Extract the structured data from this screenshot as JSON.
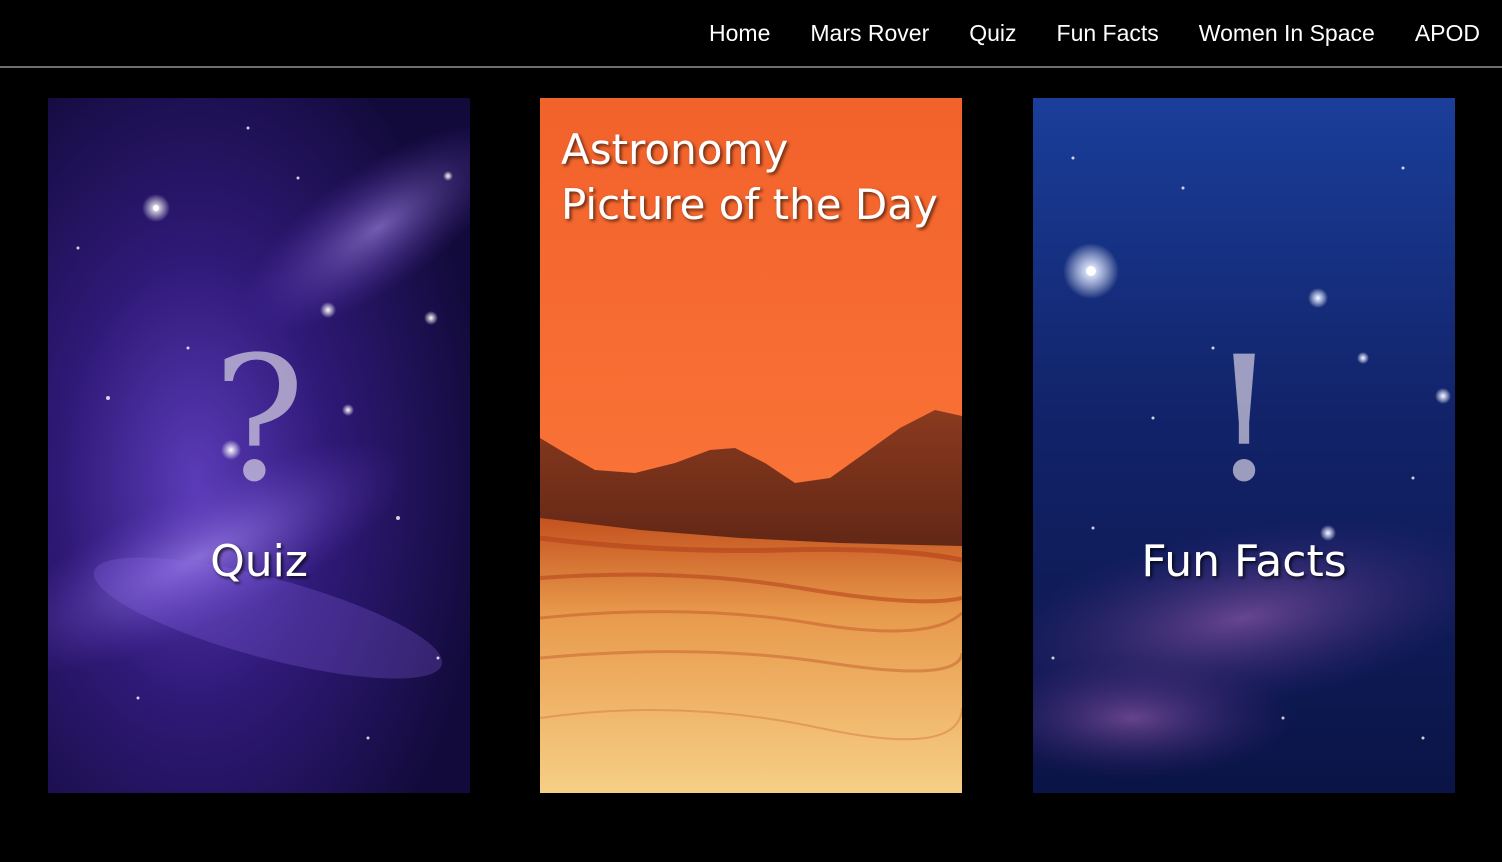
{
  "nav": {
    "items": [
      {
        "label": "Home"
      },
      {
        "label": "Mars Rover"
      },
      {
        "label": "Quiz"
      },
      {
        "label": "Fun Facts"
      },
      {
        "label": "Women In Space"
      },
      {
        "label": "APOD"
      }
    ]
  },
  "cards": {
    "quiz": {
      "symbol": "?",
      "label": "Quiz",
      "background": "purple-galaxy-image"
    },
    "apod": {
      "title_line1": "Astronomy",
      "title_line2": "Picture of the Day",
      "background": "mars-landscape-image"
    },
    "fun_facts": {
      "symbol": "!",
      "label": "Fun Facts",
      "background": "blue-starfield-image"
    }
  },
  "colors": {
    "page_background": "#000000",
    "nav_text": "#ffffff",
    "nav_divider": "#6e6e6e",
    "mars_sky_top": "#f2622b",
    "mars_sky_bottom": "#ff7f3f"
  }
}
